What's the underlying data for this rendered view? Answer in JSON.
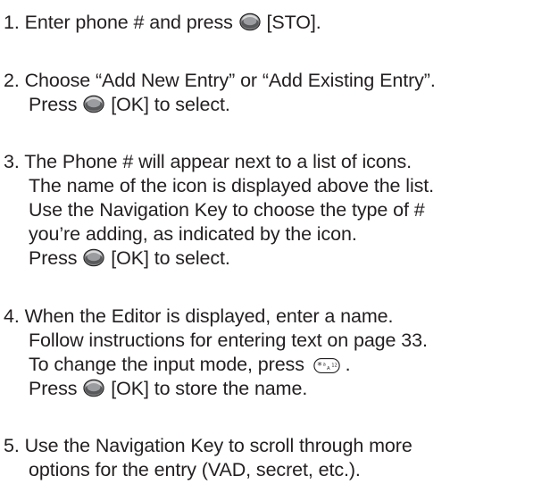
{
  "steps": [
    {
      "number": "1.",
      "lines": [
        {
          "pre": "Enter phone # and press",
          "icon": "ok-button-icon",
          "post": "[STO]."
        }
      ]
    },
    {
      "number": "2.",
      "lines": [
        {
          "text": "Choose “Add New Entry” or “Add Existing Entry”."
        },
        {
          "pre": "Press",
          "icon": "ok-button-icon",
          "post": "[OK] to select."
        }
      ]
    },
    {
      "number": "3.",
      "lines": [
        {
          "text": "The Phone # will appear next to a list of icons."
        },
        {
          "text": "The name of the icon is displayed above the list."
        },
        {
          "text": "Use the Navigation Key to choose the type of #"
        },
        {
          "text": "you’re adding, as indicated by the icon."
        },
        {
          "pre": "Press",
          "icon": "ok-button-icon",
          "post": "[OK] to select."
        }
      ]
    },
    {
      "number": "4.",
      "lines": [
        {
          "text": "When the Editor is displayed, enter a name."
        },
        {
          "text": "Follow instructions for entering text on page 33."
        },
        {
          "pre": "To change the input mode, press",
          "icon": "star-key-icon",
          "post": "."
        },
        {
          "pre": "Press",
          "icon": "ok-button-icon",
          "post": "[OK] to store the name."
        }
      ]
    },
    {
      "number": "5.",
      "lines": [
        {
          "text": "Use the Navigation Key to scroll through more"
        },
        {
          "text": "options for the entry (VAD, secret, etc.)."
        }
      ]
    }
  ],
  "colors": {
    "text": "#231f20",
    "button": "#6d6e71"
  }
}
